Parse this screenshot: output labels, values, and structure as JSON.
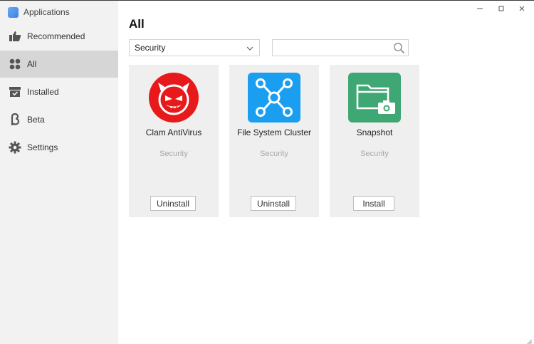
{
  "app": {
    "title": "Applications"
  },
  "sidebar": {
    "items": [
      {
        "label": "Recommended",
        "icon": "thumbs-up-icon",
        "active": false
      },
      {
        "label": "All",
        "icon": "grid-icon",
        "active": true
      },
      {
        "label": "Installed",
        "icon": "box-check-icon",
        "active": false
      },
      {
        "label": "Beta",
        "icon": "beta-icon",
        "active": false
      },
      {
        "label": "Settings",
        "icon": "gear-icon",
        "active": false
      }
    ]
  },
  "window_controls": {
    "minimize": "minimize-icon",
    "maximize": "maximize-icon",
    "close": "close-icon"
  },
  "main": {
    "title": "All",
    "filter": {
      "selected": "Security",
      "icon": "chevron-down-icon"
    },
    "search": {
      "value": "",
      "placeholder": "",
      "icon": "search-icon"
    }
  },
  "apps": [
    {
      "name": "Clam AntiVirus",
      "category": "Security",
      "action": "Uninstall",
      "icon": "clamav-devil-icon",
      "color": "#e8191b"
    },
    {
      "name": "File System Cluster",
      "category": "Security",
      "action": "Uninstall",
      "icon": "cluster-nodes-icon",
      "color": "#1a9ff0"
    },
    {
      "name": "Snapshot",
      "category": "Security",
      "action": "Install",
      "icon": "folder-camera-icon",
      "color": "#3fa774"
    }
  ],
  "colors": {
    "sidebar_bg": "#f2f2f2",
    "active_item_bg": "#d6d6d6",
    "card_bg": "#efefef"
  }
}
